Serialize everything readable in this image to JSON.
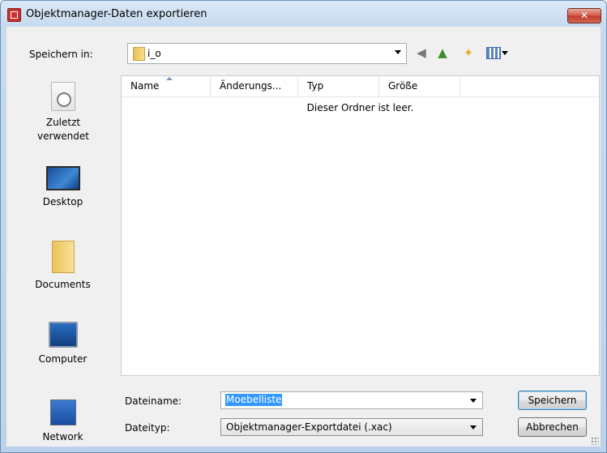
{
  "window": {
    "title": "Objektmanager-Daten exportieren",
    "close_label": "✕"
  },
  "toolbar": {
    "save_in_label": "Speichern in:",
    "save_in_value": "i_o",
    "icons": [
      "back-icon",
      "up-folder-icon",
      "new-folder-icon",
      "views-menu-icon"
    ]
  },
  "places": [
    {
      "label": "Zuletzt verwendet",
      "icon": "recent-places-icon"
    },
    {
      "label": "Desktop",
      "icon": "desktop-icon"
    },
    {
      "label": "Documents",
      "icon": "documents-icon"
    },
    {
      "label": "Computer",
      "icon": "computer-icon"
    },
    {
      "label": "Network",
      "icon": "network-icon"
    }
  ],
  "file_list": {
    "columns": [
      "Name",
      "Änderungs...",
      "Typ",
      "Größe"
    ],
    "empty_message": "Dieser Ordner ist leer."
  },
  "form": {
    "filename_label": "Dateiname:",
    "filename_value": "Moebelliste",
    "filetype_label": "Dateityp:",
    "filetype_value": "Objektmanager-Exportdatei (.xac)"
  },
  "buttons": {
    "save": "Speichern",
    "cancel": "Abbrechen"
  },
  "colors": {
    "selection": "#3399ff",
    "close_button": "#c1382b"
  }
}
